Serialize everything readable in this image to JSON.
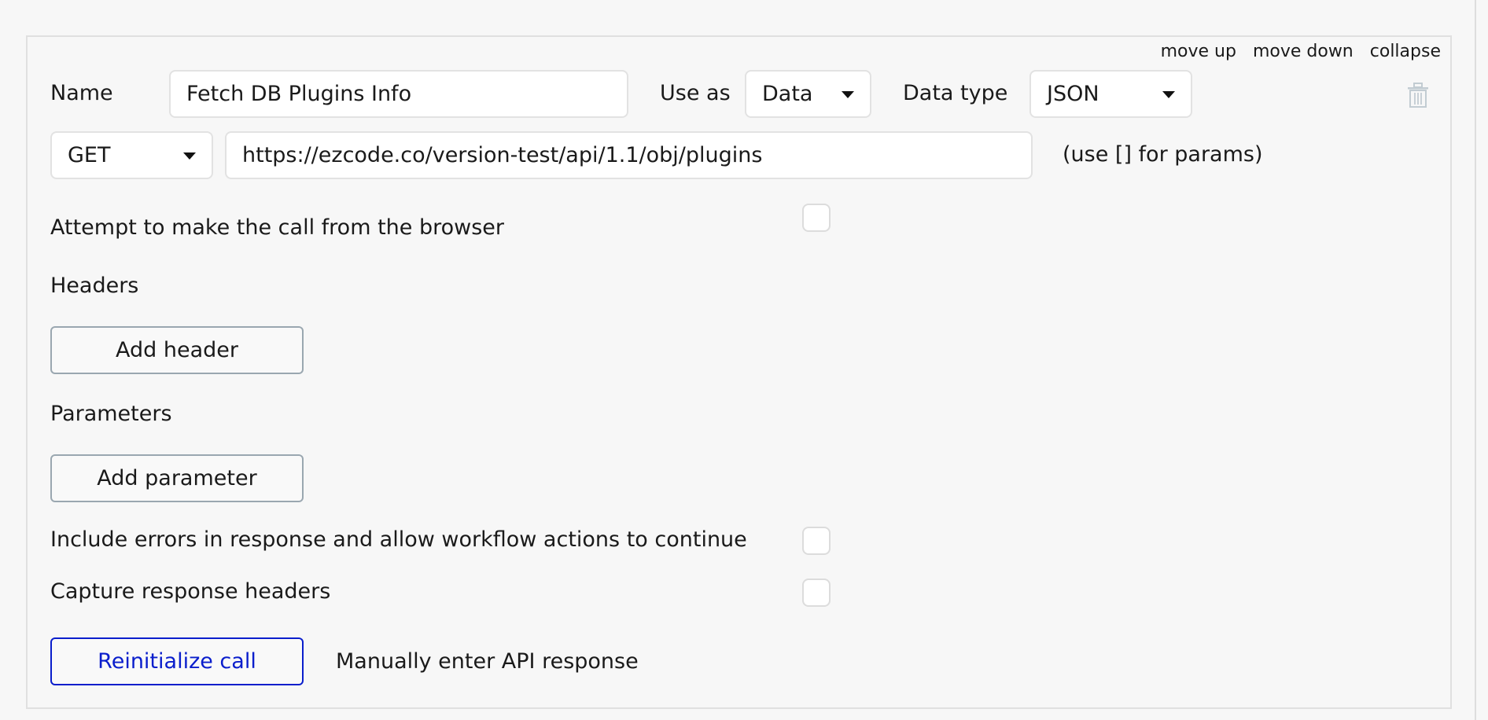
{
  "panel": {
    "top_links": {
      "move_up": "move up",
      "move_down": "move down",
      "collapse": "collapse"
    },
    "name": {
      "label": "Name",
      "value": "Fetch DB Plugins Info"
    },
    "use_as": {
      "label": "Use as",
      "value": "Data"
    },
    "data_type": {
      "label": "Data type",
      "value": "JSON"
    },
    "delete_icon": "trash-icon",
    "request": {
      "method": "GET",
      "url": "https://ezcode.co/version-test/api/1.1/obj/plugins",
      "hint": "(use [] for params)"
    },
    "browser_call": {
      "label": "Attempt to make the call from the browser",
      "checked": false
    },
    "headers": {
      "title": "Headers",
      "add_label": "Add header"
    },
    "parameters": {
      "title": "Parameters",
      "add_label": "Add parameter"
    },
    "include_errors": {
      "label": "Include errors in response and allow workflow actions to continue",
      "checked": false
    },
    "capture_headers": {
      "label": "Capture response headers",
      "checked": false
    },
    "actions": {
      "reinitialize": "Reinitialize call",
      "manual_entry": "Manually enter API response"
    },
    "colors": {
      "primary": "#0a1ecc",
      "border": "#e0e0e0",
      "background": "#f7f7f7"
    }
  }
}
